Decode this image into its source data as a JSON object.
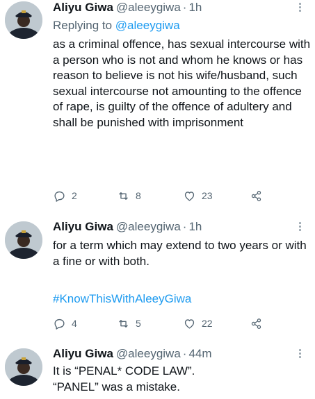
{
  "tweets": [
    {
      "author": {
        "name": "Aliyu Giwa",
        "handle": "@aleeygiwa"
      },
      "separator": "·",
      "time": "1h",
      "replying_prefix": "Replying to",
      "replying_to": "@aleeygiwa",
      "text": "as a criminal offence, has sexual intercourse with a person who is not and whom he knows or has reason to believe is not his wife/husband, such sexual intercourse not amounting to the offence of rape, is guilty of the offence of adultery and shall be punished with imprisonment",
      "replies": "2",
      "retweets": "8",
      "likes": "23"
    },
    {
      "author": {
        "name": "Aliyu Giwa",
        "handle": "@aleeygiwa"
      },
      "separator": "·",
      "time": "1h",
      "text": "for a term which may extend to two years or with a fine or with both.",
      "hashtag": "#KnowThisWithAleeyGiwa",
      "replies": "4",
      "retweets": "5",
      "likes": "22"
    },
    {
      "author": {
        "name": "Aliyu Giwa",
        "handle": "@aleeygiwa"
      },
      "separator": "·",
      "time": "44m",
      "text": "It is “PENAL* CODE LAW”.\n“PANEL” was a mistake."
    }
  ],
  "icons": {
    "reply": "reply-icon",
    "retweet": "retweet-icon",
    "like": "heart-icon",
    "share": "share-icon",
    "more": "more-icon"
  },
  "colors": {
    "text": "#0f1419",
    "secondary": "#536471",
    "link": "#1d9bf0"
  }
}
